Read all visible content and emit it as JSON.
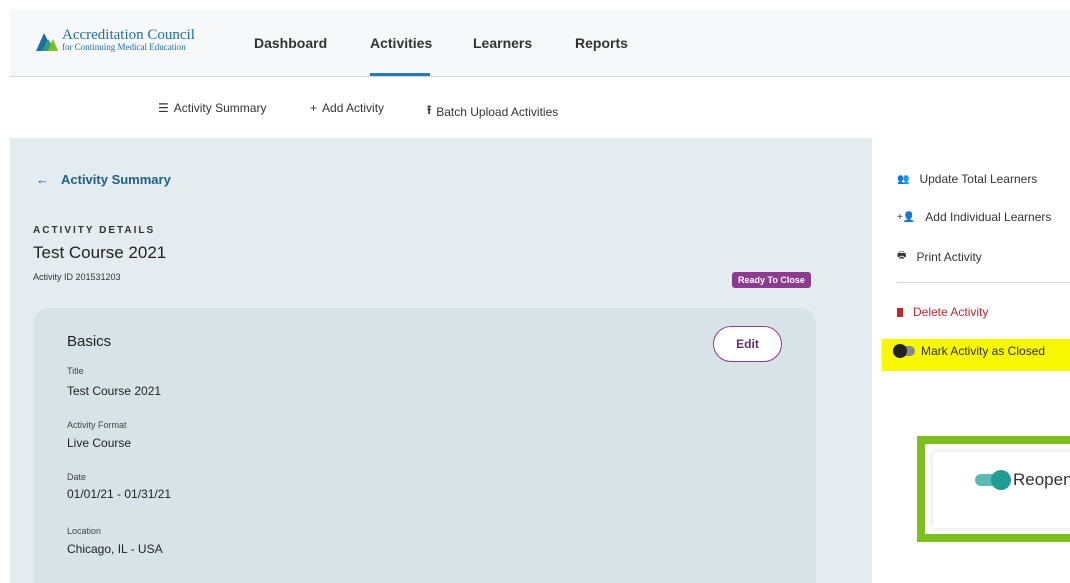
{
  "brand": {
    "name": "Accreditation Council",
    "tagline": "for Continuing Medical Education"
  },
  "nav": {
    "dashboard": "Dashboard",
    "activities": "Activities",
    "learners": "Learners",
    "reports": "Reports"
  },
  "subnav": {
    "summary": "Activity Summary",
    "add": "Add Activity",
    "batch": "Batch Upload Activities"
  },
  "main": {
    "back_label": "Activity Summary",
    "section_label": "ACTIVITY DETAILS",
    "title": "Test Course 2021",
    "activity_id": "Activity ID 201531203",
    "status": "Ready To Close"
  },
  "basics": {
    "heading": "Basics",
    "edit_label": "Edit",
    "fields": [
      {
        "label": "Title",
        "value": "Test Course 2021"
      },
      {
        "label": "Activity Format",
        "value": "Live Course"
      },
      {
        "label": "Date",
        "value": "01/01/21 - 01/31/21"
      },
      {
        "label": "Location",
        "value": "Chicago, IL - USA"
      }
    ]
  },
  "side": {
    "update_learners": "Update Total Learners",
    "add_learners": "Add Individual Learners",
    "print": "Print Activity",
    "delete": "Delete Activity",
    "mark_closed": "Mark Activity as Closed",
    "reopen": "Reopen"
  },
  "colors": {
    "brand": "#1d6fa5",
    "badge": "#8c3b8e",
    "highlight": "#f7f800",
    "reopen_border": "#7cbf1e",
    "toggle_on": "#1f9c95",
    "danger": "#c4262e"
  }
}
